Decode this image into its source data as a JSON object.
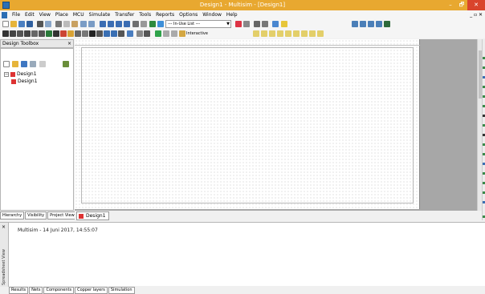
{
  "window": {
    "title": "Design1 - Multisim - [Design1]",
    "controls": {
      "minimize": "–",
      "maximize": "🗗",
      "close": "✕"
    }
  },
  "menu": [
    "File",
    "Edit",
    "View",
    "Place",
    "MCU",
    "Simulate",
    "Transfer",
    "Tools",
    "Reports",
    "Options",
    "Window",
    "Help"
  ],
  "mdi_controls": "_ ▫ ✕",
  "toolbar": {
    "in_use_list": "--- In-Use List ---",
    "simulation_mode": "Interactive"
  },
  "design_toolbox": {
    "title": "Design Toolbox",
    "tree": [
      {
        "label": "Design1",
        "level": 0
      },
      {
        "label": "Design1",
        "level": 1
      }
    ],
    "tabs": [
      "Hierarchy",
      "Visibility",
      "Project View"
    ]
  },
  "sheet_tabs": [
    "Design1"
  ],
  "spreadsheet": {
    "side_label": "Spreadsheet View",
    "log_line": "Multisim  -  14 Juni 2017, 14:55:07",
    "tabs": [
      "Results",
      "Nets",
      "Components",
      "Copper layers",
      "Simulation"
    ]
  },
  "colors": {
    "titlebar": "#e8a830",
    "close_button": "#d9442c",
    "workspace": "#a7a7a7"
  }
}
